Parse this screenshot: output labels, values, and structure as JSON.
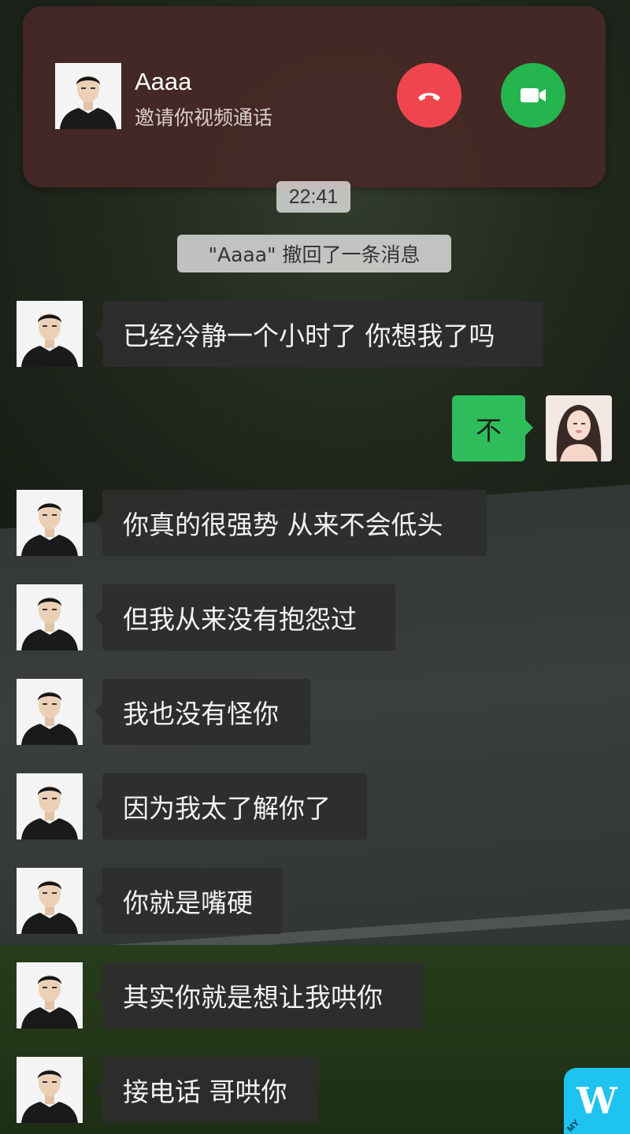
{
  "call": {
    "caller_name": "Aaaa",
    "subtitle": "邀请你视频通话",
    "decline_icon": "phone-hangup-icon",
    "accept_icon": "video-camera-icon",
    "decline_color": "#f0454e",
    "accept_color": "#25b54e"
  },
  "chat": {
    "time": "22:41",
    "system_notice": "\"Aaaa\" 撤回了一条消息",
    "messages": [
      {
        "direction": "in",
        "text": "已经冷静一个小时了 你想我了吗"
      },
      {
        "direction": "out",
        "text": "不"
      },
      {
        "direction": "in",
        "text": "你真的很强势 从来不会低头"
      },
      {
        "direction": "in",
        "text": "但我从来没有抱怨过"
      },
      {
        "direction": "in",
        "text": "我也没有怪你"
      },
      {
        "direction": "in",
        "text": "因为我太了解你了"
      },
      {
        "direction": "in",
        "text": "你就是嘴硬"
      },
      {
        "direction": "in",
        "text": "其实你就是想让我哄你"
      },
      {
        "direction": "in",
        "text": "接电话 哥哄你"
      }
    ]
  },
  "watermark": {
    "letter": "W",
    "small": "MY",
    "color": "#1ec3f0"
  }
}
